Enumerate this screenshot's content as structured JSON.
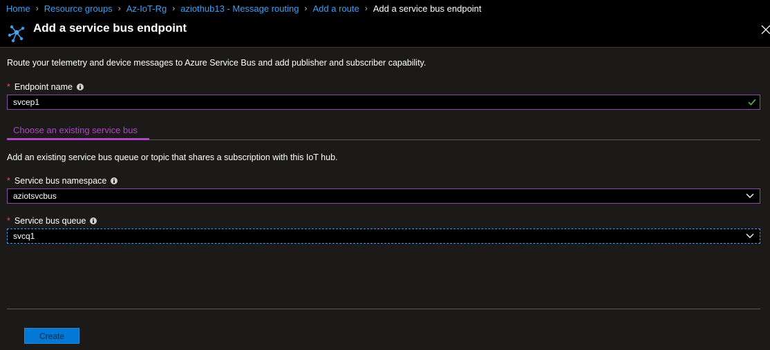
{
  "breadcrumb": {
    "items": [
      "Home",
      "Resource groups",
      "Az-IoT-Rg",
      "aziothub13 - Message routing",
      "Add a route"
    ],
    "current": "Add a service bus endpoint"
  },
  "blade": {
    "title": "Add a service bus endpoint",
    "icon": "service-bus-icon"
  },
  "form": {
    "description": "Route your telemetry and device messages to Azure Service Bus and add publisher and subscriber capability.",
    "endpoint_name": {
      "label": "Endpoint name",
      "value": "svcep1",
      "valid": true
    },
    "tab": {
      "label": "Choose an existing service bus"
    },
    "tab_description": "Add an existing service bus queue or topic that shares a subscription with this IoT hub.",
    "namespace": {
      "label": "Service bus namespace",
      "value": "aziotsvcbus"
    },
    "queue": {
      "label": "Service bus queue",
      "value": "svcq1"
    }
  },
  "footer": {
    "create_label": "Create"
  },
  "colors": {
    "accent": "#b146c2",
    "link": "#3aa0f3",
    "primary_button": "#0078d4",
    "valid": "#57a64a",
    "required": "#e74c5b"
  }
}
